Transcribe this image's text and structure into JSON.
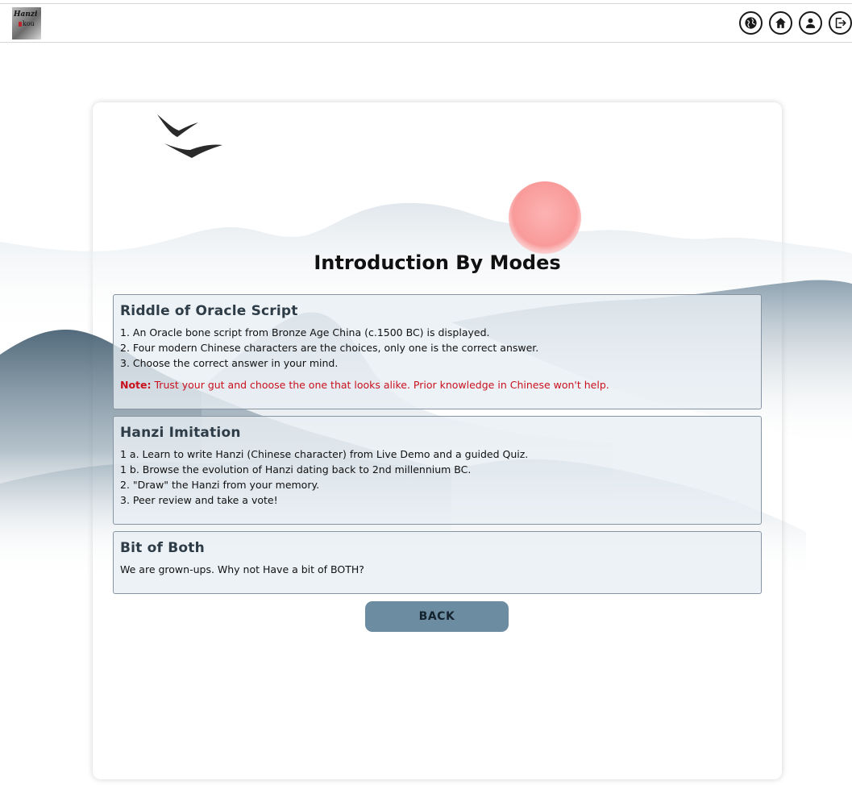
{
  "app": {
    "logo_text_line1": "Hanzi",
    "logo_text_line2": "kou",
    "nav_icons": [
      "globe-icon",
      "home-icon",
      "user-icon",
      "logout-icon"
    ]
  },
  "page": {
    "title": "Introduction By Modes"
  },
  "modes": [
    {
      "title": "Riddle of Oracle Script",
      "lines": [
        "1. An Oracle bone script from Bronze Age China (c.1500 BC) is displayed.",
        "2. Four modern Chinese characters are the choices, only one is the correct answer.",
        "3. Choose the correct answer in your mind."
      ],
      "note_label": "Note:",
      "note_text": "Trust your gut and choose the one that looks alike. Prior knowledge in Chinese won't help."
    },
    {
      "title": "Hanzi Imitation",
      "lines": [
        "1 a. Learn to write Hanzi (Chinese character) from Live Demo and a guided Quiz.",
        "1 b. Browse the evolution of Hanzi dating back to 2nd millennium BC.",
        "2. \"Draw\" the Hanzi from your memory.",
        "3. Peer review and take a vote!"
      ]
    },
    {
      "title": "Bit of Both",
      "lines": [
        "We are grown-ups. Why not Have a bit of BOTH?"
      ]
    }
  ],
  "actions": {
    "back_label": "BACK"
  },
  "colors": {
    "accent_button": "#6c8ca1",
    "note_red": "#c9111e",
    "sun": "#fca5a5",
    "mountain_dark": "#4a6478",
    "mountain_light": "#b9c7d1"
  }
}
